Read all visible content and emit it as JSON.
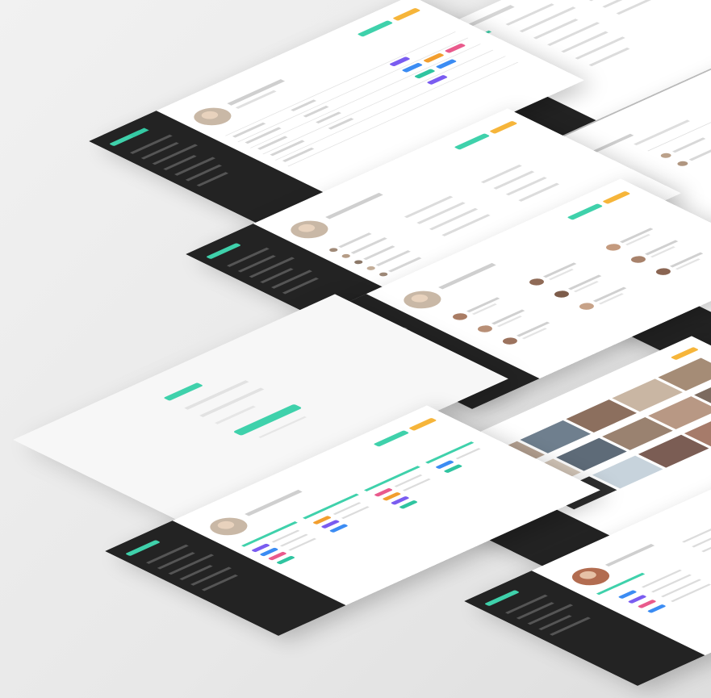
{
  "colors": {
    "background": "#ececec",
    "sidebar": "#232323",
    "sidebar_item": "#555555",
    "sidebar_active": "#34c9a3",
    "accent": "#3fd1ab",
    "accent_orange": "#f6b53a",
    "panel": "#ffffff",
    "text_line": "#d6d6d6",
    "text_dark": "#8a8a8a",
    "badge_purple": "#7a5cf0",
    "badge_blue": "#3b8cf3",
    "badge_orange": "#f29e2e",
    "badge_pink": "#e95a8c",
    "badge_teal": "#2fc4a0"
  },
  "screens": [
    {
      "id": "team-list",
      "sidebar": true,
      "avatar": true,
      "tags": true
    },
    {
      "id": "settings-form",
      "sidebar": true,
      "avatar": false,
      "tags": false
    },
    {
      "id": "member-table",
      "sidebar": true,
      "avatar": true,
      "tags": false
    },
    {
      "id": "profile-detail",
      "sidebar": true,
      "avatar": true,
      "tags": false
    },
    {
      "id": "contacts-grid",
      "sidebar": true,
      "avatar": true,
      "tags": false
    },
    {
      "id": "settings-list",
      "sidebar": true,
      "avatar": false,
      "tags": false
    },
    {
      "id": "login",
      "sidebar": false,
      "avatar": false,
      "tags": false
    },
    {
      "id": "photo-gallery",
      "sidebar": true,
      "avatar": false,
      "tags": false
    },
    {
      "id": "board-columns",
      "sidebar": true,
      "avatar": true,
      "tags": true
    },
    {
      "id": "user-profile",
      "sidebar": true,
      "avatar": true,
      "tags": false
    },
    {
      "id": "edge-screen",
      "sidebar": true,
      "avatar": false,
      "tags": false
    }
  ]
}
